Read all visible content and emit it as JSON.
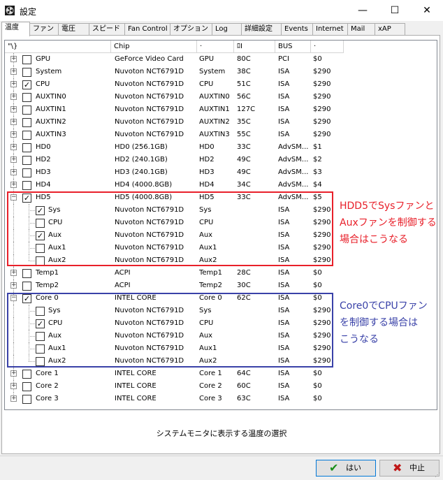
{
  "window": {
    "title": "設定",
    "minimize": "—",
    "maximize": "☐",
    "close": "✕"
  },
  "tabs": [
    "温度",
    "ファン",
    "電圧",
    "スピード",
    "Fan Control",
    "オプション",
    "Log",
    "詳細設定",
    "Events",
    "Internet",
    "Mail",
    "xAP"
  ],
  "columns": [
    "\"\\}",
    "Chip",
    "·",
    "ﾛI",
    "BUS",
    "·"
  ],
  "rows": [
    {
      "name": "GPU",
      "chip": "GeForce Video Card",
      "sensor": "GPU",
      "temp": "80C",
      "bus": "PCI",
      "addr": "$0",
      "checked": false,
      "child": false
    },
    {
      "name": "System",
      "chip": "Nuvoton NCT6791D",
      "sensor": "System",
      "temp": "38C",
      "bus": "ISA",
      "addr": "$290",
      "checked": false,
      "child": false
    },
    {
      "name": "CPU",
      "chip": "Nuvoton NCT6791D",
      "sensor": "CPU",
      "temp": "51C",
      "bus": "ISA",
      "addr": "$290",
      "checked": true,
      "child": false
    },
    {
      "name": "AUXTIN0",
      "chip": "Nuvoton NCT6791D",
      "sensor": "AUXTIN0",
      "temp": "56C",
      "bus": "ISA",
      "addr": "$290",
      "checked": false,
      "child": false
    },
    {
      "name": "AUXTIN1",
      "chip": "Nuvoton NCT6791D",
      "sensor": "AUXTIN1",
      "temp": "127C",
      "bus": "ISA",
      "addr": "$290",
      "checked": false,
      "child": false
    },
    {
      "name": "AUXTIN2",
      "chip": "Nuvoton NCT6791D",
      "sensor": "AUXTIN2",
      "temp": "35C",
      "bus": "ISA",
      "addr": "$290",
      "checked": false,
      "child": false
    },
    {
      "name": "AUXTIN3",
      "chip": "Nuvoton NCT6791D",
      "sensor": "AUXTIN3",
      "temp": "55C",
      "bus": "ISA",
      "addr": "$290",
      "checked": false,
      "child": false
    },
    {
      "name": "HD0",
      "chip": "HD0 (256.1GB)",
      "sensor": "HD0",
      "temp": "33C",
      "bus": "AdvSM...",
      "addr": "$1",
      "checked": false,
      "child": false
    },
    {
      "name": "HD2",
      "chip": "HD2 (240.1GB)",
      "sensor": "HD2",
      "temp": "49C",
      "bus": "AdvSM...",
      "addr": "$2",
      "checked": false,
      "child": false
    },
    {
      "name": "HD3",
      "chip": "HD3 (240.1GB)",
      "sensor": "HD3",
      "temp": "49C",
      "bus": "AdvSM...",
      "addr": "$3",
      "checked": false,
      "child": false
    },
    {
      "name": "HD4",
      "chip": "HD4 (4000.8GB)",
      "sensor": "HD4",
      "temp": "34C",
      "bus": "AdvSM...",
      "addr": "$4",
      "checked": false,
      "child": false
    },
    {
      "name": "HD5",
      "chip": "HD5 (4000.8GB)",
      "sensor": "HD5",
      "temp": "33C",
      "bus": "AdvSM...",
      "addr": "$5",
      "checked": true,
      "child": false,
      "expanded": true
    },
    {
      "name": "Sys",
      "chip": "Nuvoton NCT6791D",
      "sensor": "Sys",
      "temp": "",
      "bus": "ISA",
      "addr": "$290",
      "checked": true,
      "child": true
    },
    {
      "name": "CPU",
      "chip": "Nuvoton NCT6791D",
      "sensor": "CPU",
      "temp": "",
      "bus": "ISA",
      "addr": "$290",
      "checked": false,
      "child": true
    },
    {
      "name": "Aux",
      "chip": "Nuvoton NCT6791D",
      "sensor": "Aux",
      "temp": "",
      "bus": "ISA",
      "addr": "$290",
      "checked": true,
      "child": true
    },
    {
      "name": "Aux1",
      "chip": "Nuvoton NCT6791D",
      "sensor": "Aux1",
      "temp": "",
      "bus": "ISA",
      "addr": "$290",
      "checked": false,
      "child": true
    },
    {
      "name": "Aux2",
      "chip": "Nuvoton NCT6791D",
      "sensor": "Aux2",
      "temp": "",
      "bus": "ISA",
      "addr": "$290",
      "checked": false,
      "child": true
    },
    {
      "name": "Temp1",
      "chip": "ACPI",
      "sensor": "Temp1",
      "temp": "28C",
      "bus": "ISA",
      "addr": "$0",
      "checked": false,
      "child": false
    },
    {
      "name": "Temp2",
      "chip": "ACPI",
      "sensor": "Temp2",
      "temp": "30C",
      "bus": "ISA",
      "addr": "$0",
      "checked": false,
      "child": false
    },
    {
      "name": "Core 0",
      "chip": "INTEL CORE",
      "sensor": "Core 0",
      "temp": "62C",
      "bus": "ISA",
      "addr": "$0",
      "checked": true,
      "child": false,
      "expanded": true
    },
    {
      "name": "Sys",
      "chip": "Nuvoton NCT6791D",
      "sensor": "Sys",
      "temp": "",
      "bus": "ISA",
      "addr": "$290",
      "checked": false,
      "child": true
    },
    {
      "name": "CPU",
      "chip": "Nuvoton NCT6791D",
      "sensor": "CPU",
      "temp": "",
      "bus": "ISA",
      "addr": "$290",
      "checked": true,
      "child": true
    },
    {
      "name": "Aux",
      "chip": "Nuvoton NCT6791D",
      "sensor": "Aux",
      "temp": "",
      "bus": "ISA",
      "addr": "$290",
      "checked": false,
      "child": true
    },
    {
      "name": "Aux1",
      "chip": "Nuvoton NCT6791D",
      "sensor": "Aux1",
      "temp": "",
      "bus": "ISA",
      "addr": "$290",
      "checked": false,
      "child": true
    },
    {
      "name": "Aux2",
      "chip": "Nuvoton NCT6791D",
      "sensor": "Aux2",
      "temp": "",
      "bus": "ISA",
      "addr": "$290",
      "checked": false,
      "child": true
    },
    {
      "name": "Core 1",
      "chip": "INTEL CORE",
      "sensor": "Core 1",
      "temp": "64C",
      "bus": "ISA",
      "addr": "$0",
      "checked": false,
      "child": false
    },
    {
      "name": "Core 2",
      "chip": "INTEL CORE",
      "sensor": "Core 2",
      "temp": "60C",
      "bus": "ISA",
      "addr": "$0",
      "checked": false,
      "child": false
    },
    {
      "name": "Core 3",
      "chip": "INTEL CORE",
      "sensor": "Core 3",
      "temp": "63C",
      "bus": "ISA",
      "addr": "$0",
      "checked": false,
      "child": false
    }
  ],
  "annotations": {
    "hdd5": {
      "lines": [
        "HDD5でSysファンと",
        "Auxファンを制御する",
        "場合はこうなる"
      ],
      "color": "#e8202a"
    },
    "core0": {
      "lines": [
        "Core0でCPUファン",
        "を制御する場合は",
        "こうなる"
      ],
      "color": "#3a42a8"
    }
  },
  "status": "システムモニタに表示する温度の選択",
  "buttons": {
    "ok": "はい",
    "cancel": "中止"
  },
  "colors": {
    "ok_icon": "#1a8f1a",
    "cancel_icon": "#c01818"
  }
}
